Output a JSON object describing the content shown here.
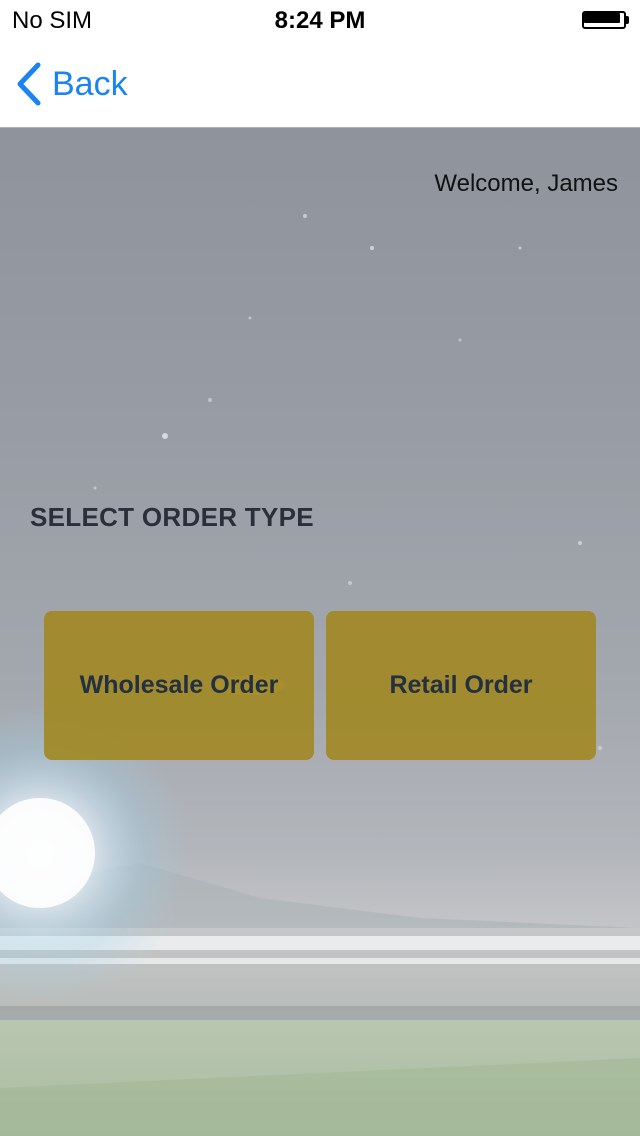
{
  "status_bar": {
    "carrier": "No SIM",
    "time": "8:24 PM",
    "battery_level": 1.0
  },
  "nav": {
    "back_label": "Back",
    "back_icon": "chevron-left-icon"
  },
  "content": {
    "welcome_text": "Welcome, James",
    "section_title": "SELECT ORDER TYPE",
    "buttons": [
      {
        "label": "Wholesale Order"
      },
      {
        "label": "Retail Order"
      }
    ]
  },
  "colors": {
    "accent": "#1a84f5",
    "button_fill": "#a0861e",
    "button_text": "#233040"
  }
}
